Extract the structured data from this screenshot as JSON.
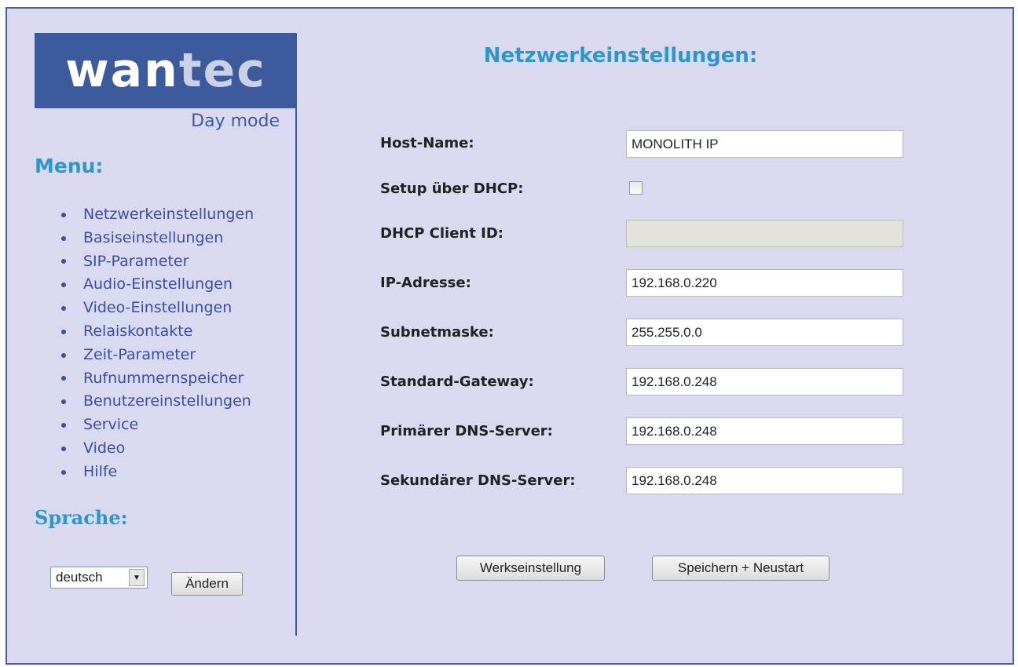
{
  "sidebar": {
    "logo": {
      "part1": "wan",
      "part2": "tec"
    },
    "mode": "Day mode",
    "menu_title": "Menu:",
    "items": [
      "Netzwerkeinstellungen",
      "Basiseinstellungen",
      "SIP-Parameter",
      "Audio-Einstellungen",
      "Video-Einstellungen",
      "Relaiskontakte",
      "Zeit-Parameter",
      "Rufnummernspeicher",
      "Benutzereinstellungen",
      "Service",
      "Video",
      "Hilfe"
    ],
    "language_title": "Sprache:",
    "language_value": "deutsch",
    "change_button": "Ändern"
  },
  "main": {
    "title": "Netzwerkeinstellungen:",
    "fields": {
      "hostname": {
        "label": "Host-Name:",
        "value": "MONOLITH IP"
      },
      "dhcp": {
        "label": "Setup über DHCP:",
        "checked": false
      },
      "dhcp_client_id": {
        "label": "DHCP Client ID:",
        "value": ""
      },
      "ip": {
        "label": "IP-Adresse:",
        "value": "192.168.0.220"
      },
      "subnet": {
        "label": "Subnetmaske:",
        "value": "255.255.0.0"
      },
      "gateway": {
        "label": "Standard-Gateway:",
        "value": "192.168.0.248"
      },
      "dns1": {
        "label": "Primärer DNS-Server:",
        "value": "192.168.0.248"
      },
      "dns2": {
        "label": "Sekundärer DNS-Server:",
        "value": "192.168.0.248"
      }
    },
    "buttons": {
      "factory": "Werkseinstellung",
      "save": "Speichern + Neustart"
    }
  },
  "colors": {
    "background": "#d9d9ef",
    "logo_bg": "#3d5a9c",
    "heading": "#2f96c9",
    "menu_link": "#3a4fa0"
  }
}
